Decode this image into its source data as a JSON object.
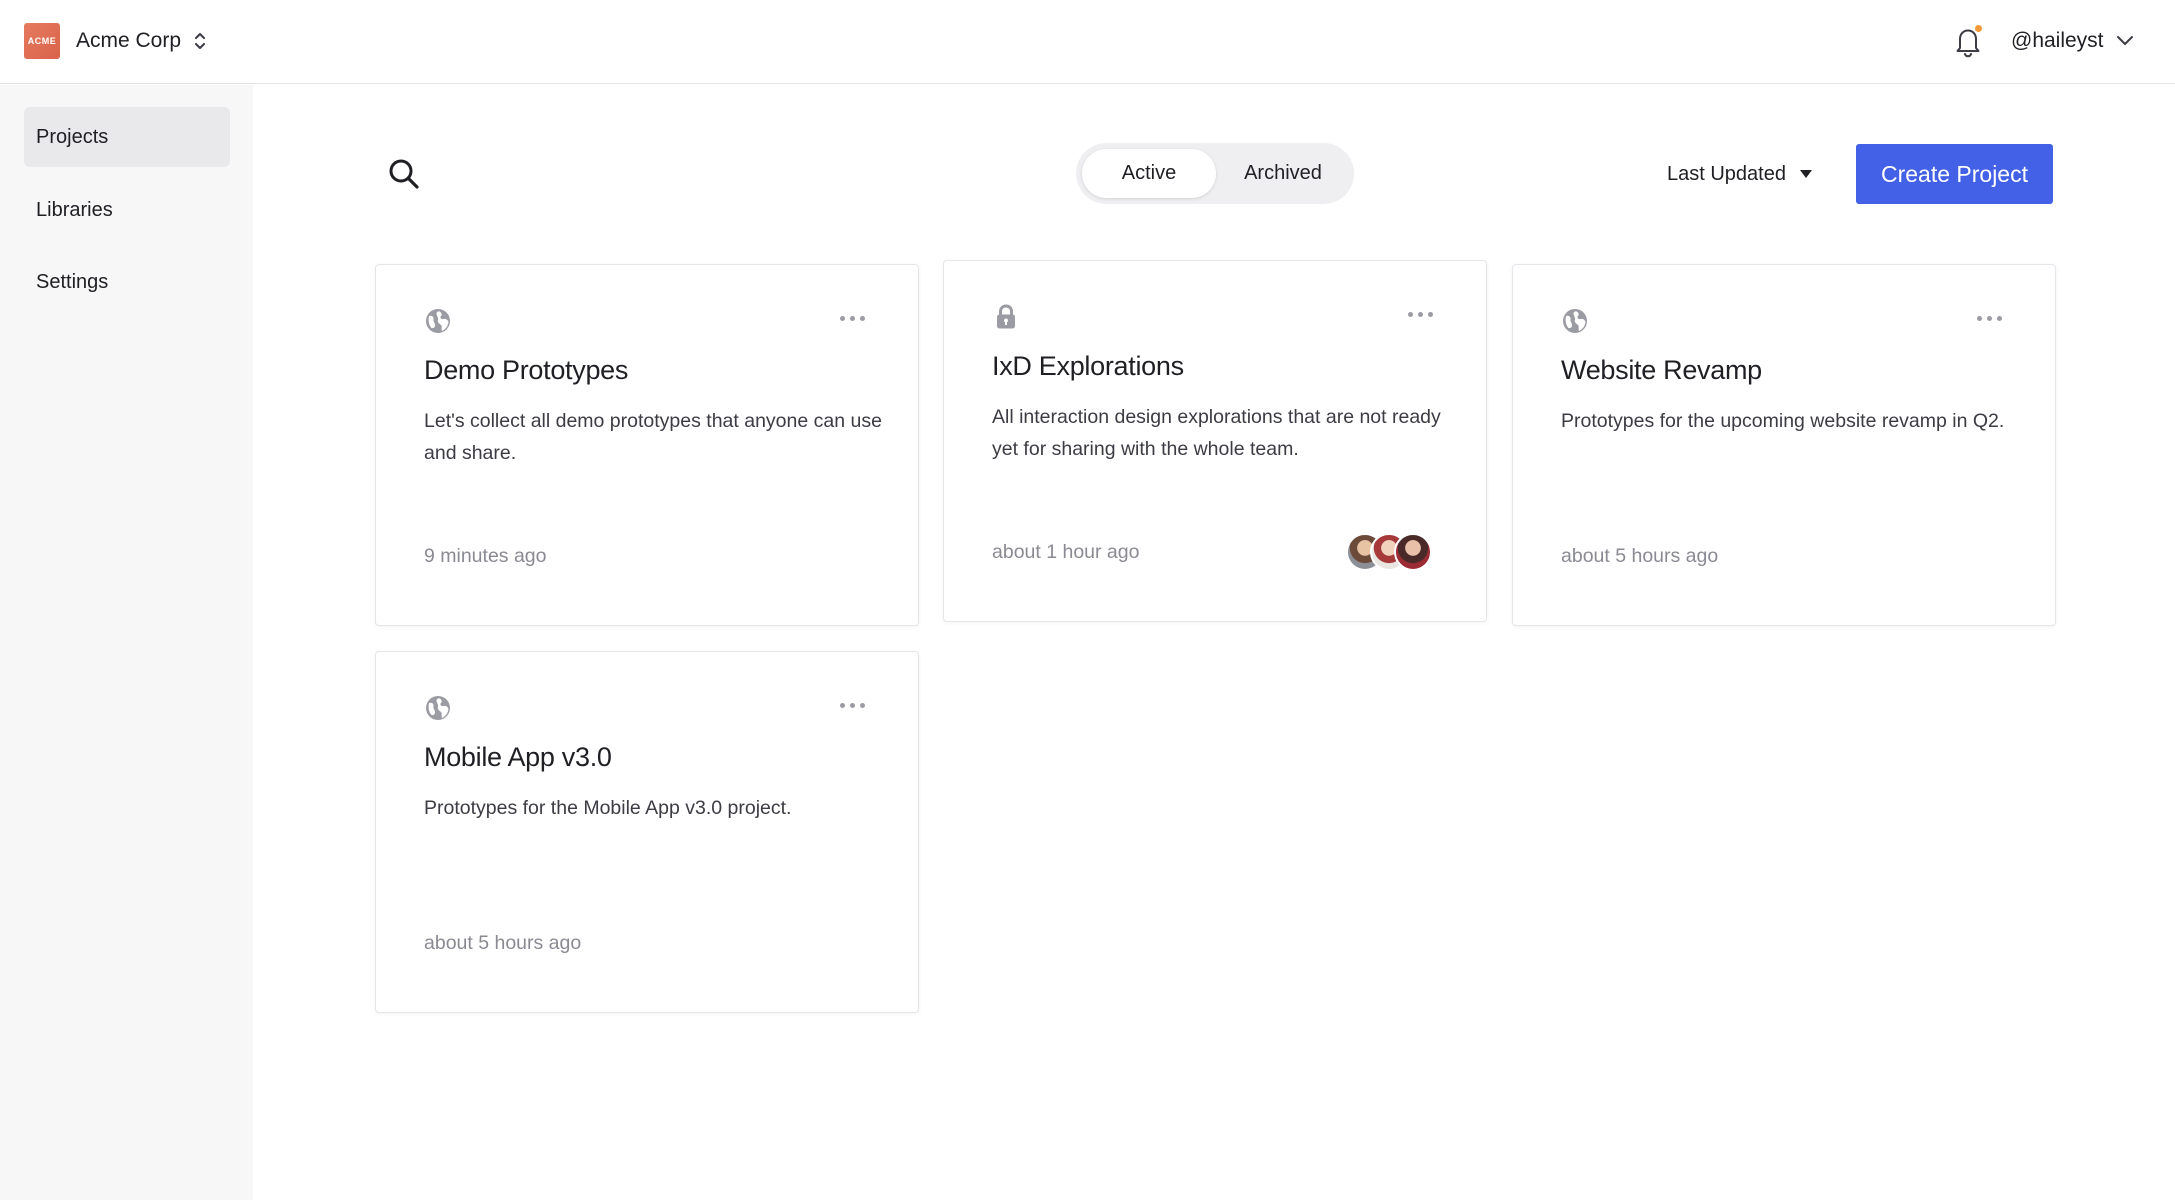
{
  "header": {
    "org_logo_text": "ACME",
    "org_name": "Acme Corp",
    "username": "@haileyst",
    "notification_dot_color": "#f29a38"
  },
  "sidebar": {
    "items": [
      {
        "label": "Projects",
        "active": true
      },
      {
        "label": "Libraries",
        "active": false
      },
      {
        "label": "Settings",
        "active": false
      }
    ]
  },
  "toolbar": {
    "tabs": [
      {
        "label": "Active",
        "selected": true
      },
      {
        "label": "Archived",
        "selected": false
      }
    ],
    "sort_label": "Last Updated",
    "create_label": "Create Project",
    "accent_color": "#4361e6"
  },
  "projects": [
    {
      "title": "Demo Prototypes",
      "description": "Let's collect all demo prototypes that anyone can use and share.",
      "updated": "9 minutes ago",
      "visibility_icon": "globe-icon"
    },
    {
      "title": "IxD Explorations",
      "description": "All interaction design explorations that are not ready yet for sharing with the whole team.",
      "updated": "about 1 hour ago",
      "visibility_icon": "lock-icon"
    },
    {
      "title": "Website Revamp",
      "description": "Prototypes for the upcoming website revamp in Q2.",
      "updated": "about 5 hours ago",
      "visibility_icon": "globe-icon"
    },
    {
      "title": "Mobile App v3.0",
      "description": "Prototypes for the Mobile App v3.0 project.",
      "updated": "about 5 hours ago",
      "visibility_icon": "globe-icon"
    }
  ]
}
